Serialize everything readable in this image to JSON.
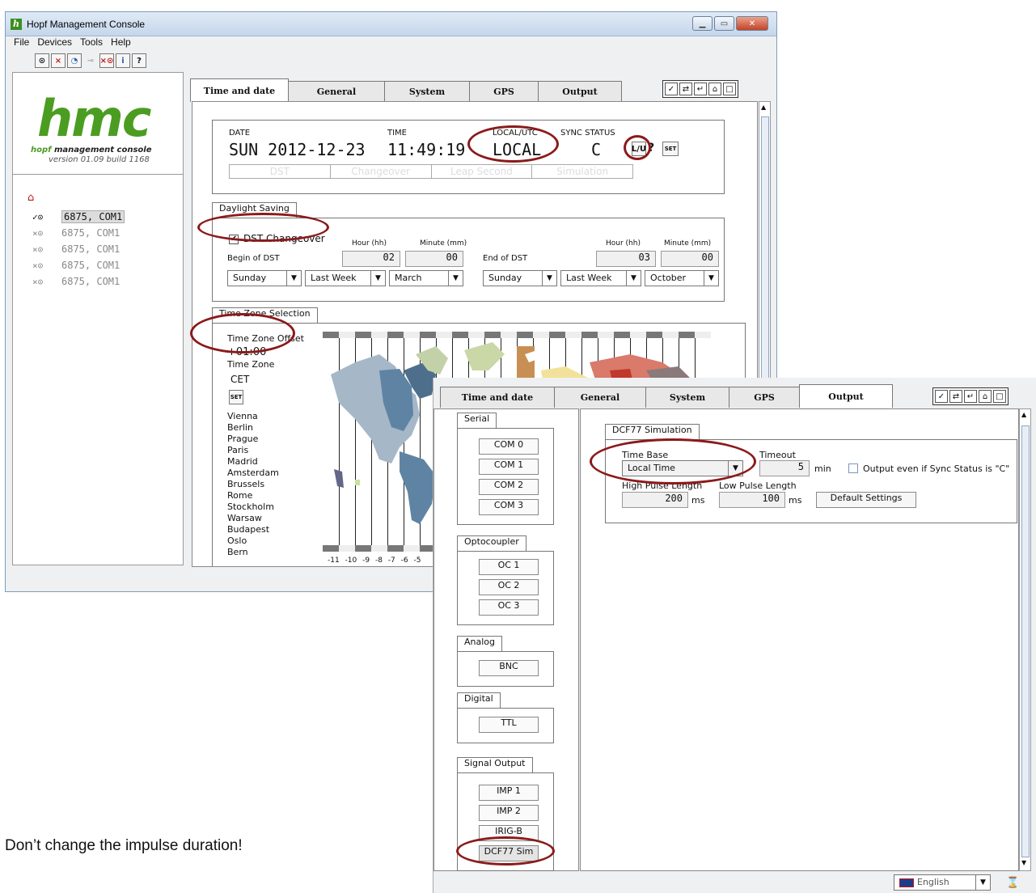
{
  "window1": {
    "title": "Hopf Management Console",
    "menu": [
      "File",
      "Devices",
      "Tools",
      "Help"
    ],
    "toolbar_icons": [
      "clock-icon",
      "close-icon",
      "refresh-icon",
      "disconnect-icon",
      "remove-clock-icon",
      "info-icon",
      "help-icon"
    ],
    "logo": {
      "brand": "hmc",
      "subtitle_hopf": "hopf",
      "subtitle_rest": " management console",
      "version": "version 01.09 build 1168"
    },
    "devices": [
      {
        "prefix": "✓⊙",
        "label": "6875, COM1",
        "selected": true
      },
      {
        "prefix": "×⊙",
        "label": "6875, COM1",
        "selected": false
      },
      {
        "prefix": "×⊙",
        "label": "6875, COM1",
        "selected": false
      },
      {
        "prefix": "×⊙",
        "label": "6875, COM1",
        "selected": false
      },
      {
        "prefix": "×⊙",
        "label": "6875, COM1",
        "selected": false
      }
    ],
    "tabs": [
      "Time and date",
      "General",
      "System",
      "GPS",
      "Output"
    ],
    "active_tab": "Time and date",
    "status": {
      "date_label": "DATE",
      "date_value": "SUN 2012-12-23",
      "time_label": "TIME",
      "time_value": "11:49:19",
      "localutc_label": "LOCAL/UTC",
      "localutc_value": "LOCAL",
      "sync_label": "SYNC STATUS",
      "sync_value": "C",
      "buttons": [
        "L/U",
        "?",
        "SET"
      ],
      "flags": [
        "DST",
        "Changeover",
        "Leap Second",
        "Simulation"
      ]
    },
    "daylight": {
      "group_label": "Daylight Saving",
      "check_label": "DST Changeover",
      "hour_label": "Hour (hh)",
      "minute_label": "Minute (mm)",
      "begin_label": "Begin of DST",
      "begin_hour": "02",
      "begin_minute": "00",
      "begin_day": "Sunday",
      "begin_week": "Last Week",
      "begin_month": "March",
      "end_label": "End of DST",
      "end_hour": "03",
      "end_minute": "00",
      "end_day": "Sunday",
      "end_week": "Last Week",
      "end_month": "October"
    },
    "timezone": {
      "group_label": "Time Zone Selection",
      "offset_label": "Time Zone Offset",
      "offset_value": "+01:00",
      "zone_label": "Time Zone",
      "zone_value": "CET",
      "set_label": "SET",
      "cities": [
        "Vienna",
        "Berlin",
        "Prague",
        "Paris",
        "Madrid",
        "Amsterdam",
        "Brussels",
        "Rome",
        "Stockholm",
        "Warsaw",
        "Budapest",
        "Oslo",
        "Bern"
      ],
      "axis": "-11 -10 -9 -8 -7 -6 -5"
    }
  },
  "window2": {
    "tabs": [
      "Time and date",
      "General",
      "System",
      "GPS",
      "Output"
    ],
    "active_tab": "Output",
    "groups": {
      "serial": {
        "label": "Serial",
        "items": [
          "COM 0",
          "COM 1",
          "COM 2",
          "COM 3"
        ]
      },
      "opto": {
        "label": "Optocoupler",
        "items": [
          "OC 1",
          "OC 2",
          "OC 3"
        ]
      },
      "analog": {
        "label": "Analog",
        "items": [
          "BNC"
        ]
      },
      "digital": {
        "label": "Digital",
        "items": [
          "TTL"
        ]
      },
      "signal": {
        "label": "Signal Output",
        "items": [
          "IMP 1",
          "IMP 2",
          "IRIG-B",
          "DCF77 Sim"
        ]
      }
    },
    "dcf": {
      "group_label": "DCF77 Simulation",
      "timebase_label": "Time Base",
      "timebase_value": "Local Time",
      "timeout_label": "Timeout",
      "timeout_value": "5",
      "timeout_unit": "min",
      "output_even_label": "Output even if Sync Status is \"C\"",
      "high_label": "High Pulse Length",
      "high_value": "200",
      "high_unit": "ms",
      "low_label": "Low Pulse Length",
      "low_value": "100",
      "low_unit": "ms",
      "default_button": "Default Settings"
    },
    "language": "English"
  },
  "note": "Don’t change the impulse duration!",
  "colors": {
    "annotation": "#8b1a1a",
    "brand_green": "#4b9d21"
  }
}
